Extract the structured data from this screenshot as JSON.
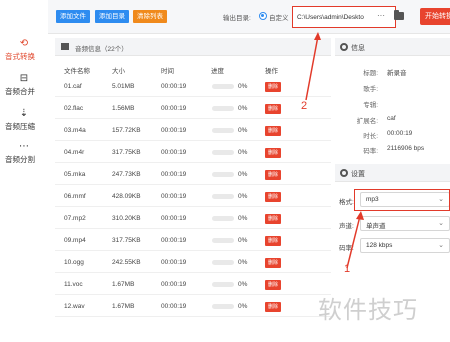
{
  "sidebar": {
    "items": [
      {
        "label": "音式转换",
        "icon": "convert-icon",
        "glyph": "⟲",
        "active": true
      },
      {
        "label": "音频合并",
        "icon": "merge-icon",
        "glyph": "⊟",
        "active": false
      },
      {
        "label": "音频压缩",
        "icon": "compress-icon",
        "glyph": "⇣",
        "active": false
      },
      {
        "label": "音频分割",
        "icon": "split-icon",
        "glyph": "⋯",
        "active": false
      }
    ]
  },
  "toolbar": {
    "add_file": "添加文件",
    "add_dir": "添加目录",
    "clear_list": "清除列表",
    "output_label": "输出目录:",
    "radio_label": "自定义",
    "path_value": "C:\\Users\\admin\\Deskto",
    "more": "···",
    "start": "开始转换"
  },
  "list": {
    "title": "音频信息（22个）",
    "columns": {
      "name": "文件名称",
      "size": "大小",
      "time": "时间",
      "progress": "进度",
      "action": "操作"
    },
    "delete_label": "删除",
    "rows": [
      {
        "name": "01.caf",
        "size": "5.01MB",
        "time": "00:00:19",
        "progress": "0%"
      },
      {
        "name": "02.flac",
        "size": "1.56MB",
        "time": "00:00:19",
        "progress": "0%"
      },
      {
        "name": "03.m4a",
        "size": "157.72KB",
        "time": "00:00:19",
        "progress": "0%"
      },
      {
        "name": "04.m4r",
        "size": "317.75KB",
        "time": "00:00:19",
        "progress": "0%"
      },
      {
        "name": "05.mka",
        "size": "247.73KB",
        "time": "00:00:19",
        "progress": "0%"
      },
      {
        "name": "06.mmf",
        "size": "428.09KB",
        "time": "00:00:19",
        "progress": "0%"
      },
      {
        "name": "07.mp2",
        "size": "310.20KB",
        "time": "00:00:19",
        "progress": "0%"
      },
      {
        "name": "09.mp4",
        "size": "317.75KB",
        "time": "00:00:19",
        "progress": "0%"
      },
      {
        "name": "10.ogg",
        "size": "242.55KB",
        "time": "00:00:19",
        "progress": "0%"
      },
      {
        "name": "11.voc",
        "size": "1.67MB",
        "time": "00:00:19",
        "progress": "0%"
      },
      {
        "name": "12.wav",
        "size": "1.67MB",
        "time": "00:00:19",
        "progress": "0%"
      }
    ]
  },
  "info": {
    "title": "信息",
    "fields": [
      {
        "key": "标题:",
        "value": "新录音"
      },
      {
        "key": "歌手:",
        "value": ""
      },
      {
        "key": "专辑:",
        "value": ""
      },
      {
        "key": "扩展名:",
        "value": "caf"
      },
      {
        "key": "时长:",
        "value": "00:00:19"
      },
      {
        "key": "码率:",
        "value": "2116906 bps"
      }
    ]
  },
  "settings": {
    "title": "设置",
    "format_label": "格式:",
    "format_value": "mp3",
    "channel_label": "声道:",
    "channel_value": "单声道",
    "bitrate_label": "码率:",
    "bitrate_value": "128 kbps"
  },
  "annotations": {
    "one": "1",
    "two": "2"
  },
  "watermark": "软件技巧",
  "colors": {
    "accent_red": "#e8442e",
    "accent_blue": "#2e8cf0",
    "orange": "#f08a1c"
  }
}
